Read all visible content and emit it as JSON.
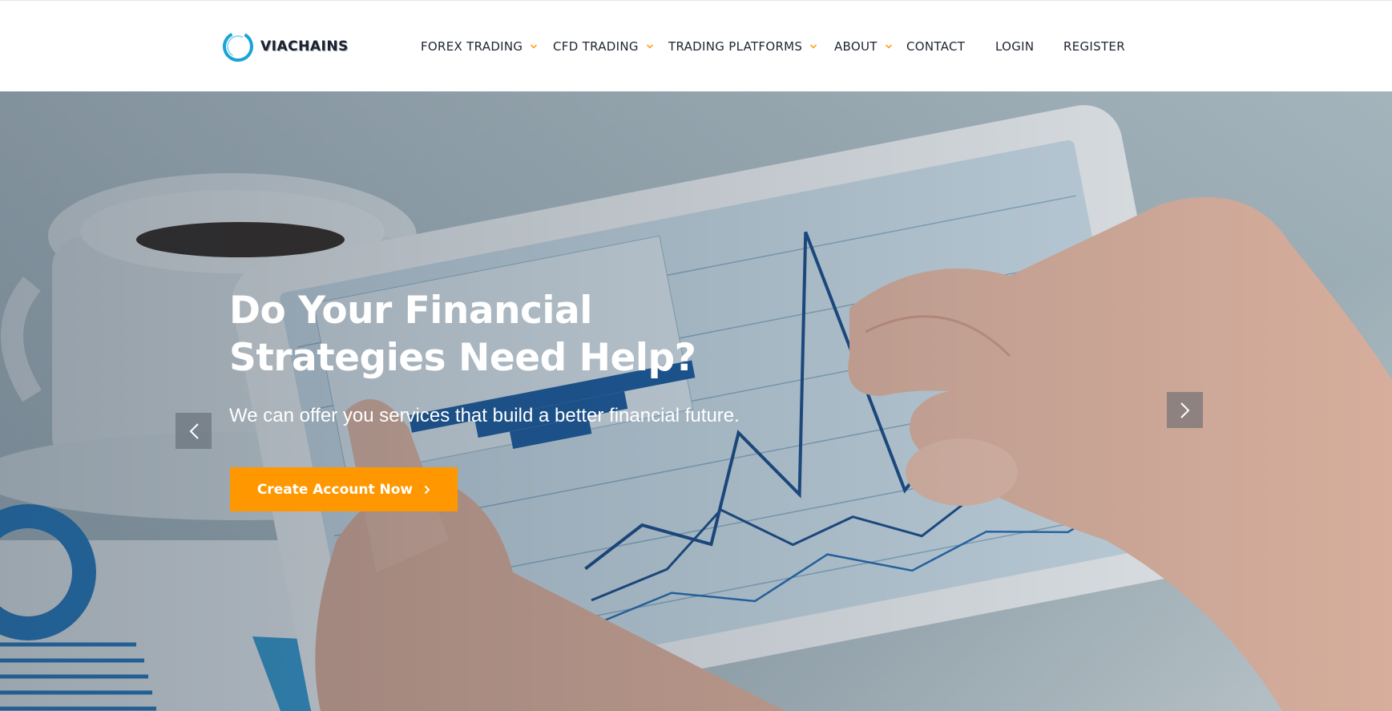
{
  "brand": {
    "name": "VIACHAINS",
    "accent_color": "#1aa3d8"
  },
  "nav": {
    "items": [
      {
        "label": "FOREX TRADING",
        "has_dropdown": true
      },
      {
        "label": "CFD TRADING",
        "has_dropdown": true
      },
      {
        "label": "TRADING PLATFORMS",
        "has_dropdown": true
      },
      {
        "label": "ABOUT",
        "has_dropdown": true
      },
      {
        "label": "CONTACT",
        "has_dropdown": false
      },
      {
        "label": "LOGIN",
        "has_dropdown": false
      },
      {
        "label": "REGISTER",
        "has_dropdown": false
      }
    ],
    "caret_color": "#ff9800"
  },
  "hero": {
    "title_line1": "Do Your Financial",
    "title_line2": "Strategies Need Help?",
    "subtitle": "We can offer you services that build a better financial future.",
    "cta_label": "Create Account Now",
    "cta_icon": "chevron-right-icon",
    "cta_color": "#ff9800",
    "prev_icon": "chevron-left-icon",
    "next_icon": "chevron-right-icon"
  }
}
